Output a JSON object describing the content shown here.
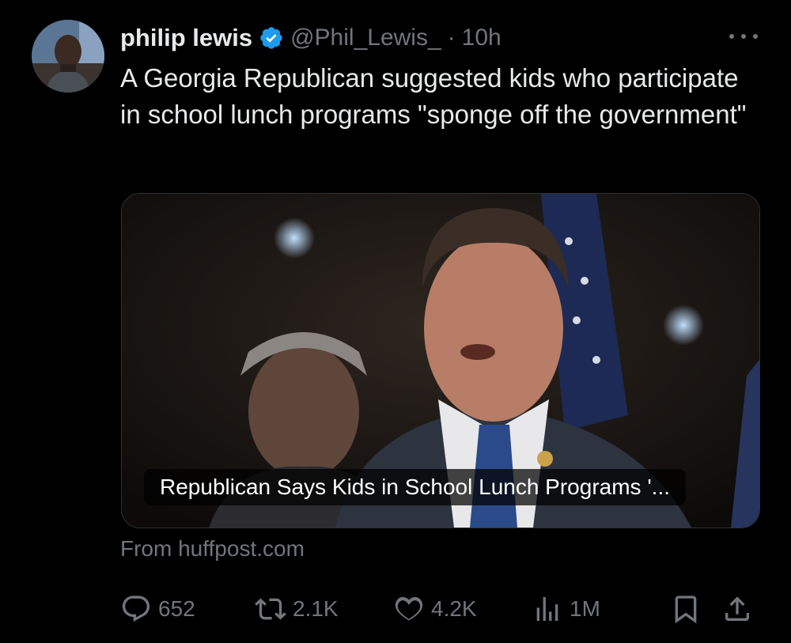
{
  "author": {
    "display_name": "philip lewis",
    "handle": "@Phil_Lewis_",
    "separator": "·",
    "time": "10h",
    "verified_color": "#1d9bf0"
  },
  "tweet": {
    "text": "A Georgia Republican suggested kids who participate in school lunch programs \"sponge off the government\""
  },
  "card": {
    "title": "Republican Says Kids in School Lunch Programs '...",
    "source": "From huffpost.com"
  },
  "actions": {
    "replies": "652",
    "reposts": "2.1K",
    "likes": "4.2K",
    "views": "1M"
  },
  "icons": [
    "verified-badge-icon",
    "more-icon",
    "reply-icon",
    "repost-icon",
    "like-icon",
    "views-icon",
    "bookmark-icon",
    "share-icon"
  ],
  "colors": {
    "background": "#000000",
    "text_primary": "#e7e9ea",
    "text_secondary": "#71767b",
    "border": "#2f3336"
  }
}
